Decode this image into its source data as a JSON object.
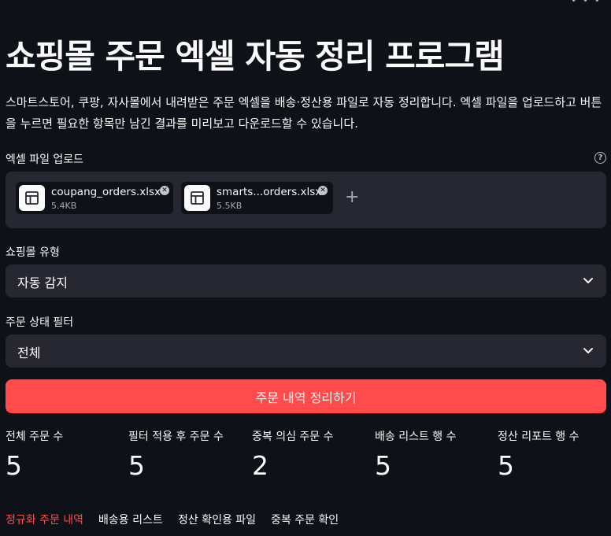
{
  "header": {
    "title": "쇼핑몰 주문 엑셀 자동 정리 프로그램",
    "description": "스마트스토어, 쿠팡, 자사몰에서 내려받은 주문 엑셀을 배송·정산용 파일로 자동 정리합니다. 엑셀 파일을 업로드하고 버튼을 누르면 필요한 항목만 남긴 결과를 미리보고 다운로드할 수 있습니다."
  },
  "uploader": {
    "label": "엑셀 파일 업로드",
    "help_icon": "question-circle-icon",
    "files": [
      {
        "name": "coupang_orders.xlsx",
        "size": "5.4KB",
        "icon": "table-icon"
      },
      {
        "name": "smarts...orders.xlsx",
        "size": "5.5KB",
        "icon": "table-icon"
      }
    ],
    "add_icon": "plus-icon"
  },
  "mall_type": {
    "label": "쇼핑몰 유형",
    "value": "자동 감지"
  },
  "status_filter": {
    "label": "주문 상태 필터",
    "value": "전체"
  },
  "action": {
    "label": "주문 내역 정리하기"
  },
  "metrics": [
    {
      "label": "전체 주문 수",
      "value": "5"
    },
    {
      "label": "필터 적용 후 주문 수",
      "value": "5"
    },
    {
      "label": "중복 의심 주문 수",
      "value": "2"
    },
    {
      "label": "배송 리스트 행 수",
      "value": "5"
    },
    {
      "label": "정산 리포트 행 수",
      "value": "5"
    }
  ],
  "tabs": [
    {
      "label": "정규화 주문 내역",
      "active": true
    },
    {
      "label": "배송용 리스트",
      "active": false
    },
    {
      "label": "정산 확인용 파일",
      "active": false
    },
    {
      "label": "중복 주문 확인",
      "active": false
    }
  ],
  "colors": {
    "background": "#0e1117",
    "surface": "#262730",
    "accent": "#ff4b4b",
    "text": "#fafafa",
    "muted": "#a3a8b8"
  }
}
